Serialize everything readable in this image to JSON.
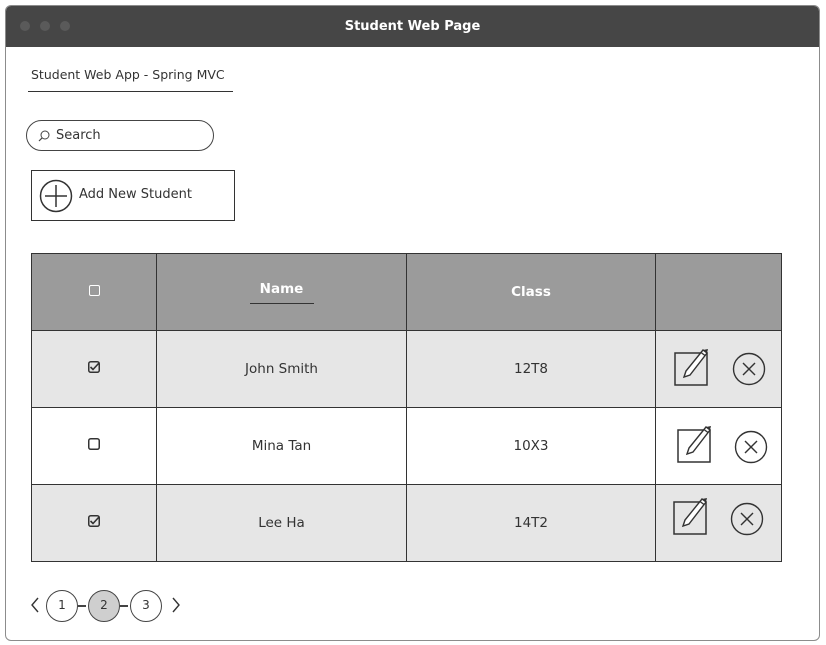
{
  "window": {
    "title": "Student Web Page"
  },
  "app": {
    "title": "Student Web App - Spring MVC"
  },
  "search": {
    "placeholder": "Search"
  },
  "toolbar": {
    "add_label": "Add New Student"
  },
  "table": {
    "headers": {
      "select": "",
      "name": "Name",
      "class": "Class",
      "actions": ""
    },
    "rows": [
      {
        "checked": true,
        "name": "John Smith",
        "class": "12T8"
      },
      {
        "checked": false,
        "name": "Mina Tan",
        "class": "10X3"
      },
      {
        "checked": true,
        "name": "Lee Ha",
        "class": "14T2"
      }
    ]
  },
  "pagination": {
    "pages": [
      "1",
      "2",
      "3"
    ],
    "current": "2"
  },
  "colors": {
    "titlebar": "#464646",
    "header_bg": "#9b9b9b",
    "row_alt": "#e6e6e6"
  },
  "icons": [
    "window-dot-icon",
    "search-icon",
    "add-circle-icon",
    "checkbox-icon",
    "edit-icon",
    "delete-icon",
    "chevron-left-icon",
    "chevron-right-icon"
  ]
}
